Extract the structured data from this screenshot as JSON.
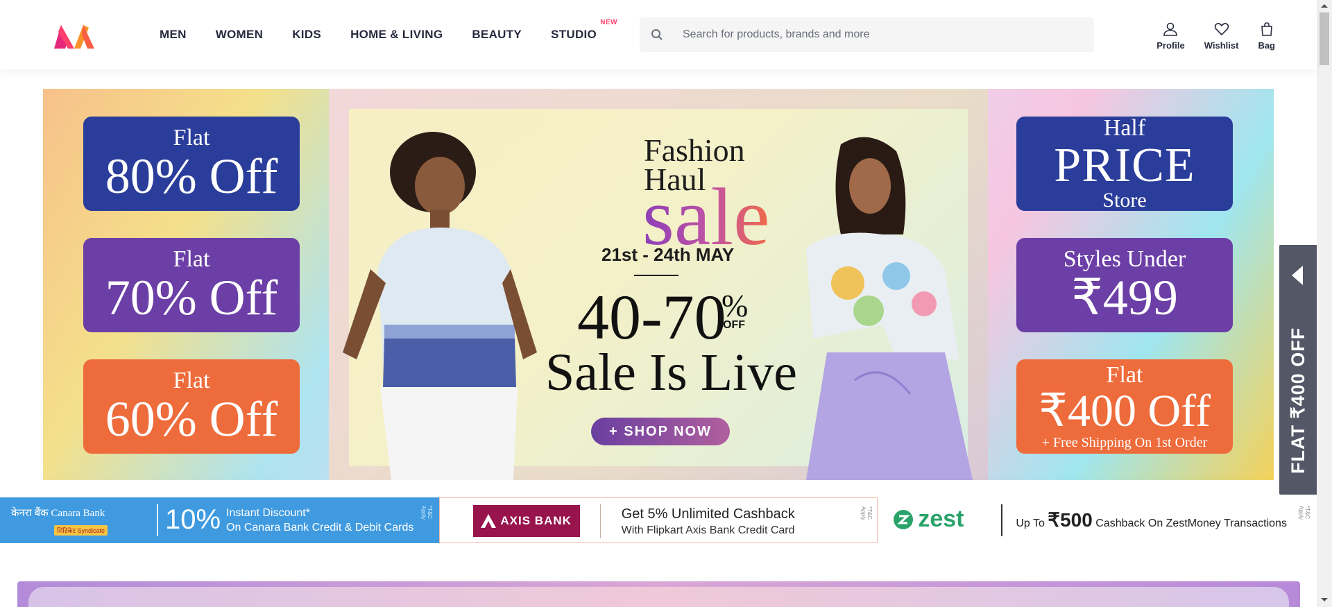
{
  "brand": {
    "logo_icon": "myntra-logo-icon",
    "accent": "#ff3f6c"
  },
  "nav": {
    "items": [
      {
        "label": "MEN"
      },
      {
        "label": "WOMEN"
      },
      {
        "label": "KIDS"
      },
      {
        "label": "HOME & LIVING"
      },
      {
        "label": "BEAUTY"
      },
      {
        "label": "STUDIO",
        "badge": "NEW"
      }
    ]
  },
  "search": {
    "placeholder": "Search for products, brands and more",
    "value": ""
  },
  "actions": {
    "profile": "Profile",
    "wishlist": "Wishlist",
    "bag": "Bag"
  },
  "hero": {
    "left_promos": [
      {
        "small": "Flat",
        "big": "80% Off"
      },
      {
        "small": "Flat",
        "big": "70% Off"
      },
      {
        "small": "Flat",
        "big": "60% Off"
      }
    ],
    "right_promos": [
      {
        "small": "Half",
        "big": "PRICE",
        "tiny": "Store"
      },
      {
        "small": "Styles Under",
        "big": "₹499"
      },
      {
        "small": "Flat",
        "big": "₹400 Off",
        "tiny": "+ Free Shipping On 1st Order"
      }
    ],
    "headline_1": "Fashion",
    "headline_2": "Haul",
    "headline_sale": "sale",
    "dates": "21st - 24th MAY",
    "discount": "40-70",
    "pct_symbol": "%",
    "pct_off": "OFF",
    "live": "Sale Is Live",
    "cta": "+ SHOP NOW"
  },
  "side_tab": {
    "text": "FLAT ₹400 OFF"
  },
  "offers": [
    {
      "bank": "केनरा बैंक Canara Bank",
      "sub": "सिंडिकेट Syndicate",
      "pct": "10%",
      "line1": "Instant Discount*",
      "line2": "On Canara Bank Credit & Debit Cards",
      "tc": "*T&C Apply"
    },
    {
      "bank": "AXIS BANK",
      "line1": "Get 5% Unlimited Cashback",
      "line2": "With Flipkart Axis Bank Credit Card",
      "tc": "*T&C Apply"
    },
    {
      "bank": "zest",
      "prefix": "Up To ",
      "amount": "₹500",
      "suffix": " Cashback On ZestMoney Transactions",
      "tc": "*T&C Apply"
    }
  ],
  "colors": {
    "promo_blue": "#2a3d9a",
    "promo_purple": "#6b3fa6",
    "promo_orange": "#ee6b3b",
    "side_tab": "#535766",
    "canara": "#3f9ae0",
    "axis": "#97144d",
    "zest": "#29a36a"
  }
}
